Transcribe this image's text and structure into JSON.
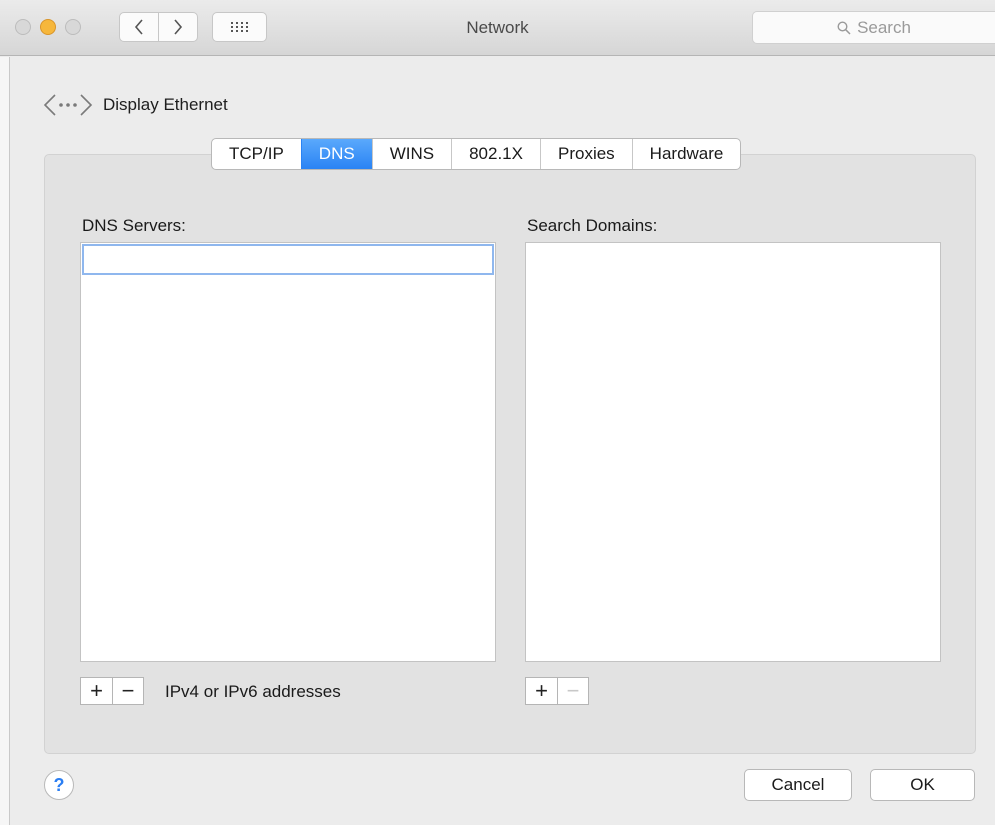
{
  "window": {
    "title": "Network",
    "search_placeholder": "Search"
  },
  "interface": {
    "name": "Display Ethernet"
  },
  "tabs": [
    {
      "label": "TCP/IP",
      "active": false
    },
    {
      "label": "DNS",
      "active": true
    },
    {
      "label": "WINS",
      "active": false
    },
    {
      "label": "802.1X",
      "active": false
    },
    {
      "label": "Proxies",
      "active": false
    },
    {
      "label": "Hardware",
      "active": false
    }
  ],
  "dns_servers": {
    "label": "DNS Servers:",
    "entries": [
      ""
    ],
    "hint": "IPv4 or IPv6 addresses"
  },
  "search_domains": {
    "label": "Search Domains:",
    "entries": []
  },
  "buttons": {
    "help": "?",
    "cancel": "Cancel",
    "ok": "OK",
    "add": "+",
    "remove": "−"
  },
  "colors": {
    "accent": "#2a83f4",
    "minimize": "#f6b73c"
  }
}
